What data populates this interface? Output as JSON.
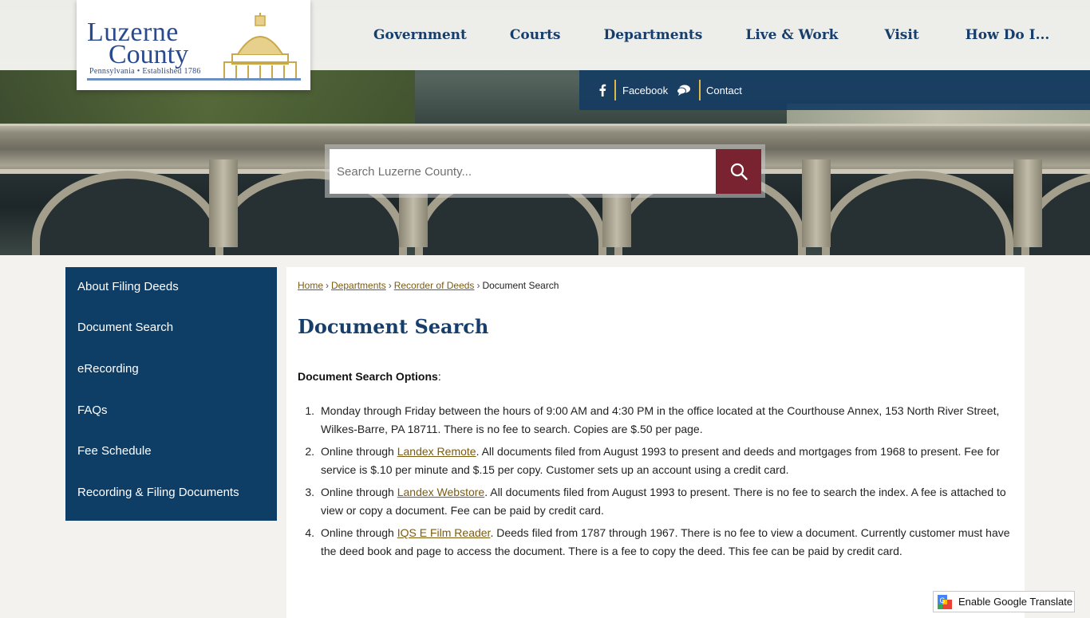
{
  "logo": {
    "line1": "Luzerne",
    "line2": "County",
    "tagline": "Pennsylvania • Established 1786"
  },
  "nav": {
    "items": [
      "Government",
      "Courts",
      "Departments",
      "Live & Work",
      "Visit",
      "How Do I..."
    ]
  },
  "social": {
    "facebook": "Facebook",
    "contact": "Contact"
  },
  "search": {
    "placeholder": "Search Luzerne County..."
  },
  "sidebar": {
    "items": [
      "About Filing Deeds",
      "Document Search",
      "eRecording",
      "FAQs",
      "Fee Schedule",
      "Recording & Filing Documents"
    ]
  },
  "breadcrumb": {
    "home": "Home",
    "departments": "Departments",
    "recorder": "Recorder of Deeds",
    "current": "Document Search"
  },
  "page": {
    "title": "Document Search",
    "subheading": "Document Search Options",
    "subheading_suffix": ":",
    "options": [
      {
        "num": "1.",
        "pre": "Monday through Friday between the hours of 9:00 AM and 4:30 PM in the office located at the Courthouse Annex, 153 North River Street, Wilkes-Barre, PA 18711. There is no fee to search. Copies are $.50 per page.",
        "link": "",
        "post": ""
      },
      {
        "num": "2.",
        "pre": "Online through ",
        "link": "Landex Remote",
        "post": ". All documents filed from August 1993 to present and deeds and mortgages from 1968 to present. Fee for  service is $.10 per minute and $.15 per copy. Customer sets up an account using a credit card."
      },
      {
        "num": "3.",
        "pre": "Online through ",
        "link": "Landex Webstore",
        "post": ". All documents filed from August 1993 to present. There is no fee to search the index. A fee is attached to view or copy a document. Fee can be paid by credit card."
      },
      {
        "num": "4.",
        "pre": "Online through ",
        "link": "IQS E Film Reader",
        "post": ". Deeds filed from 1787 through 1967. There is no fee to view a document. Currently customer must have the deed book and page to access the document. There is a fee to copy the deed. This fee can be paid by credit card."
      }
    ]
  },
  "translate": {
    "label": "Enable Google Translate"
  },
  "colors": {
    "navy": "#0e3d66",
    "heading": "#173e6b",
    "search_button": "#7a2330",
    "link": "#7a5b12",
    "accent_gold": "#e0b84a"
  }
}
